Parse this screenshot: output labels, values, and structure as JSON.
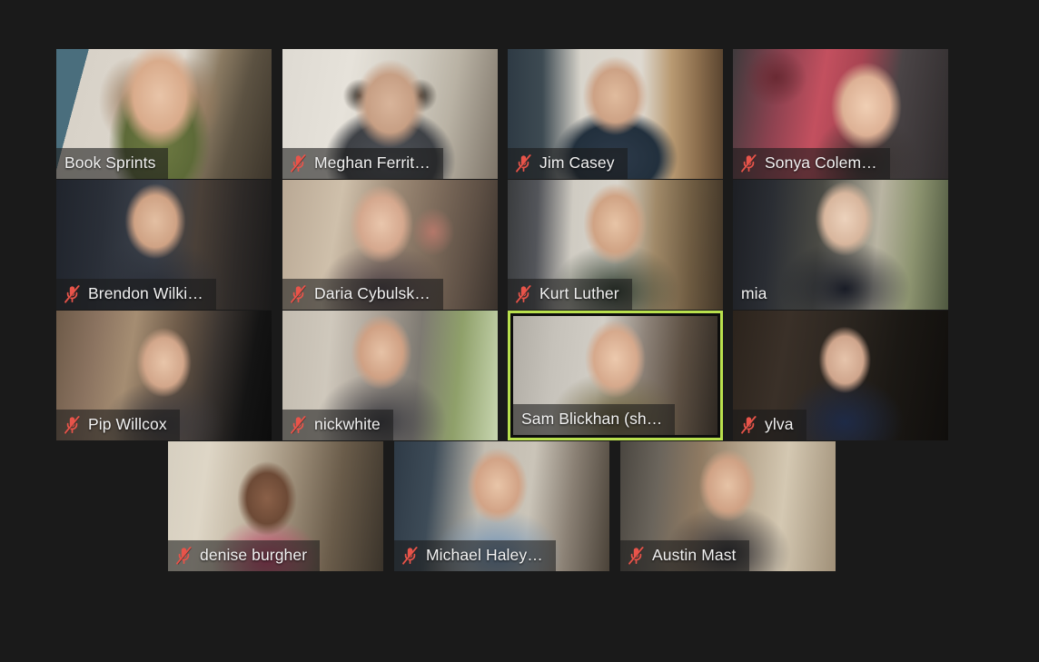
{
  "app": {
    "title": "Video conference gallery view",
    "background_color": "#1a1a1a",
    "active_speaker_border_color": "#b9e04d",
    "underbar_color": "#f4f0a2",
    "mic_muted_color": "#e8544a"
  },
  "icons": {
    "mic_muted": "mic-muted-icon"
  },
  "participants": [
    {
      "name": "Book Sprints",
      "muted": false,
      "active_speaker": false,
      "name_bar": true,
      "underbar": true,
      "video": "v-booksprints",
      "row": 1,
      "col": 1
    },
    {
      "name": "Meghan Ferrit…",
      "muted": true,
      "active_speaker": false,
      "name_bar": true,
      "underbar": false,
      "video": "v-meghan",
      "row": 1,
      "col": 2
    },
    {
      "name": "Jim Casey",
      "muted": true,
      "active_speaker": false,
      "name_bar": true,
      "underbar": false,
      "video": "v-jim",
      "row": 1,
      "col": 3
    },
    {
      "name": "Sonya Colem…",
      "muted": true,
      "active_speaker": false,
      "name_bar": true,
      "underbar": false,
      "video": "v-sonya",
      "row": 1,
      "col": 4
    },
    {
      "name": "Brendon Wilki…",
      "muted": true,
      "active_speaker": false,
      "name_bar": true,
      "underbar": false,
      "video": "v-brendon",
      "row": 2,
      "col": 1
    },
    {
      "name": "Daria Cybulsk…",
      "muted": true,
      "active_speaker": false,
      "name_bar": true,
      "underbar": false,
      "video": "v-daria",
      "row": 2,
      "col": 2
    },
    {
      "name": "Kurt Luther",
      "muted": true,
      "active_speaker": false,
      "name_bar": true,
      "underbar": false,
      "video": "v-kurt",
      "row": 2,
      "col": 3
    },
    {
      "name": "mia",
      "muted": false,
      "active_speaker": false,
      "name_bar": false,
      "underbar": false,
      "video": "v-mia",
      "row": 2,
      "col": 4
    },
    {
      "name": "Pip Willcox",
      "muted": true,
      "active_speaker": false,
      "name_bar": true,
      "underbar": false,
      "video": "v-pip",
      "row": 3,
      "col": 1
    },
    {
      "name": "nickwhite",
      "muted": true,
      "active_speaker": false,
      "name_bar": true,
      "underbar": false,
      "video": "v-nick",
      "row": 3,
      "col": 2
    },
    {
      "name": "Sam Blickhan (sh…",
      "muted": false,
      "active_speaker": true,
      "name_bar": true,
      "underbar": false,
      "video": "v-sam",
      "row": 3,
      "col": 3
    },
    {
      "name": "ylva",
      "muted": true,
      "active_speaker": false,
      "name_bar": true,
      "underbar": false,
      "video": "v-ylva",
      "row": 3,
      "col": 4
    },
    {
      "name": "denise burgher",
      "muted": true,
      "active_speaker": false,
      "name_bar": true,
      "underbar": false,
      "video": "v-denise",
      "row": 4,
      "col": 1
    },
    {
      "name": "Michael Haley…",
      "muted": true,
      "active_speaker": false,
      "name_bar": true,
      "underbar": false,
      "video": "v-michael",
      "row": 4,
      "col": 2
    },
    {
      "name": "Austin Mast",
      "muted": true,
      "active_speaker": false,
      "name_bar": true,
      "underbar": false,
      "video": "v-austin",
      "row": 4,
      "col": 3
    }
  ]
}
